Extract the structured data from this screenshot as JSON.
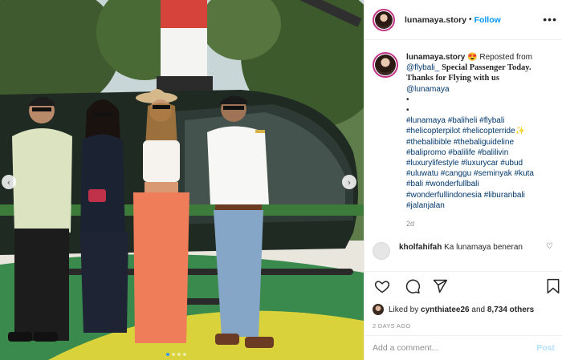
{
  "post": {
    "username": "lunamaya.story",
    "follow_label": "Follow",
    "more_glyph": "•••",
    "caption": {
      "username": "lunamaya.story",
      "emoji": "😍",
      "reposted_text": "Reposted from",
      "reposted_user": "@flybali_",
      "headline": "Special Passenger Today. Thanks for Flying with us",
      "mention": "@lunamaya",
      "bullet1": "•",
      "bullet2": "•",
      "hashtags": "#lunamaya #baliheli #flybali #helicopterpilot #helicopterride✨ #thebalibible #thebaliguideline #balipromo #balilife #balilivin #luxurylifestyle #luxurycar #ubud #uluwatu #canggu #seminyak #kuta #bali #wonderfullbali #wonderfullindonesia #liburanbali #jalanjalan",
      "age": "2d"
    },
    "comment": {
      "username": "kholfahifah",
      "text": "Ka lunamaya beneran"
    },
    "likes": {
      "prefix": "Liked by",
      "user": "cynthiatee26",
      "and": "and",
      "count": "8,734 others"
    },
    "date": "2 DAYS AGO",
    "add_comment_placeholder": "Add a comment...",
    "post_label": "Post",
    "icons": [
      "heart-icon",
      "comment-icon",
      "share-icon",
      "bookmark-icon"
    ],
    "colors": {
      "link": "#00376b",
      "follow": "#0095f6",
      "post_disabled": "#b2dffc",
      "story_ring": "#c13584"
    }
  }
}
